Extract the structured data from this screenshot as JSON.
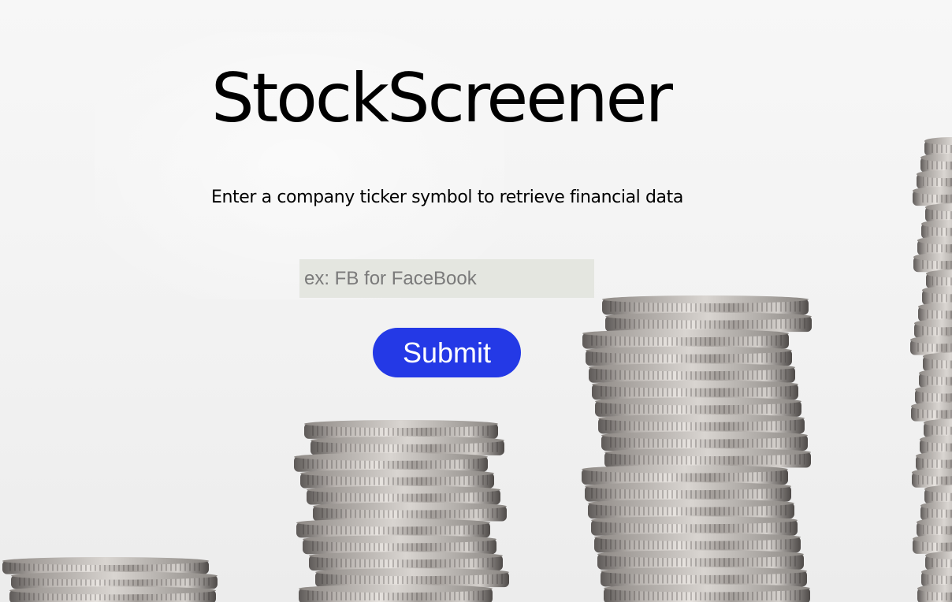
{
  "header": {
    "title": "StockScreener",
    "subtitle": "Enter a company ticker symbol to retrieve financial data"
  },
  "form": {
    "ticker_placeholder": "ex: FB for FaceBook",
    "ticker_value": "",
    "submit_label": "Submit"
  },
  "theme": {
    "button_color": "#2439e6",
    "input_background": "#e4e6e0",
    "background_image": "stacked-silver-coins-photo"
  }
}
